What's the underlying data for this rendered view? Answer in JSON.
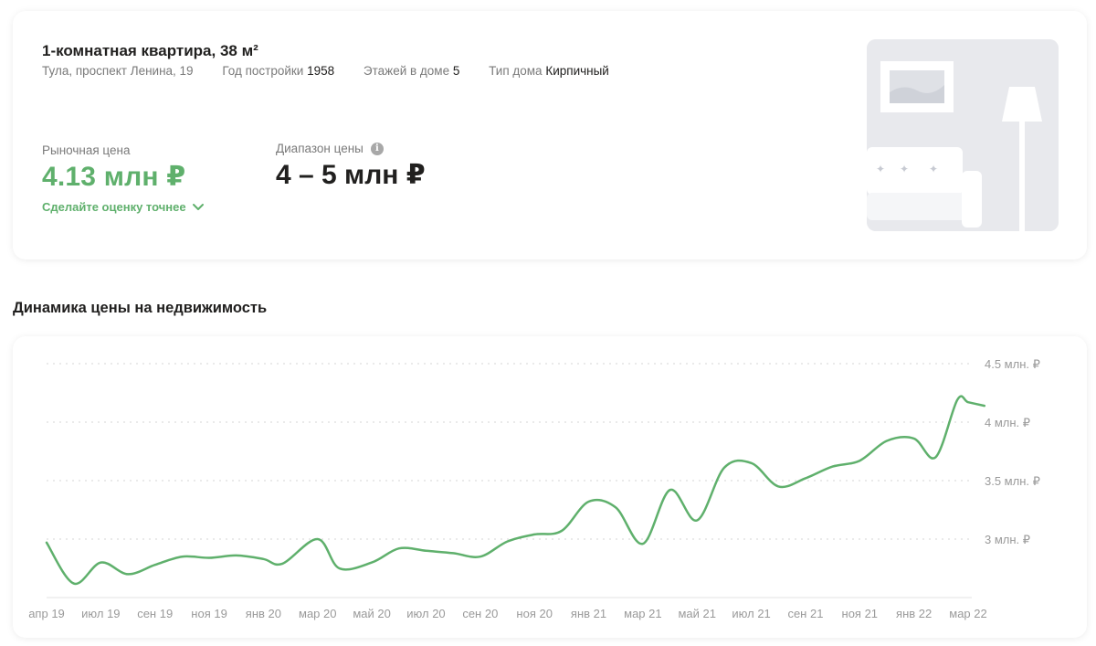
{
  "property": {
    "title": "1-комнатная квартира, 38 м²",
    "address": "Тула, проспект Ленина, 19",
    "build_year_label": "Год постройки",
    "build_year": "1958",
    "floors_label": "Этажей в доме",
    "floors": "5",
    "house_type_label": "Тип дома",
    "house_type": "Кирпичный"
  },
  "valuation": {
    "market_label": "Рыночная цена",
    "market_value": "4.13 млн ₽",
    "accuracy_link": "Сделайте оценку точнее",
    "range_label": "Диапазон цены",
    "range_value": "4 – 5 млн ₽",
    "info_icon": "i"
  },
  "icons": {
    "info": "info-icon",
    "chevron": "chevron-down-icon"
  },
  "colors": {
    "accent": "#5fb06c",
    "text": "#21201f",
    "muted": "#7a7a7a"
  },
  "section_title": "Динамика цены на недвижимость",
  "chart_data": {
    "type": "line",
    "y_ticks": [
      {
        "value": 3.0,
        "label": "3 млн. ₽"
      },
      {
        "value": 3.5,
        "label": "3.5 млн. ₽"
      },
      {
        "value": 4.0,
        "label": "4 млн. ₽"
      },
      {
        "value": 4.5,
        "label": "4.5 млн. ₽"
      }
    ],
    "ylim": [
      2.5,
      4.5
    ],
    "grid": true,
    "x_ticks": [
      "апр 19",
      "июл 19",
      "сен 19",
      "ноя 19",
      "янв 20",
      "мар 20",
      "май 20",
      "июл 20",
      "сен 20",
      "ноя 20",
      "янв 21",
      "мар 21",
      "май 21",
      "июл 21",
      "сен 21",
      "ноя 21",
      "янв 22",
      "мар 22"
    ],
    "series": [
      {
        "color": "#5fb06c",
        "points": [
          [
            0.0,
            2.97
          ],
          [
            0.5,
            2.62
          ],
          [
            1.0,
            2.8
          ],
          [
            1.5,
            2.7
          ],
          [
            2.0,
            2.78
          ],
          [
            2.5,
            2.85
          ],
          [
            3.0,
            2.84
          ],
          [
            3.5,
            2.86
          ],
          [
            4.0,
            2.83
          ],
          [
            4.35,
            2.79
          ],
          [
            5.0,
            3.0
          ],
          [
            5.4,
            2.75
          ],
          [
            6.0,
            2.8
          ],
          [
            6.5,
            2.92
          ],
          [
            7.0,
            2.9
          ],
          [
            7.5,
            2.88
          ],
          [
            8.0,
            2.85
          ],
          [
            8.5,
            2.98
          ],
          [
            9.0,
            3.04
          ],
          [
            9.5,
            3.07
          ],
          [
            10.0,
            3.32
          ],
          [
            10.5,
            3.27
          ],
          [
            11.0,
            2.96
          ],
          [
            11.5,
            3.42
          ],
          [
            12.0,
            3.16
          ],
          [
            12.5,
            3.61
          ],
          [
            13.0,
            3.65
          ],
          [
            13.5,
            3.45
          ],
          [
            14.0,
            3.52
          ],
          [
            14.5,
            3.62
          ],
          [
            15.0,
            3.67
          ],
          [
            15.5,
            3.84
          ],
          [
            16.0,
            3.86
          ],
          [
            16.4,
            3.7
          ],
          [
            16.8,
            4.19
          ],
          [
            17.0,
            4.17
          ],
          [
            17.3,
            4.14
          ]
        ]
      }
    ]
  }
}
